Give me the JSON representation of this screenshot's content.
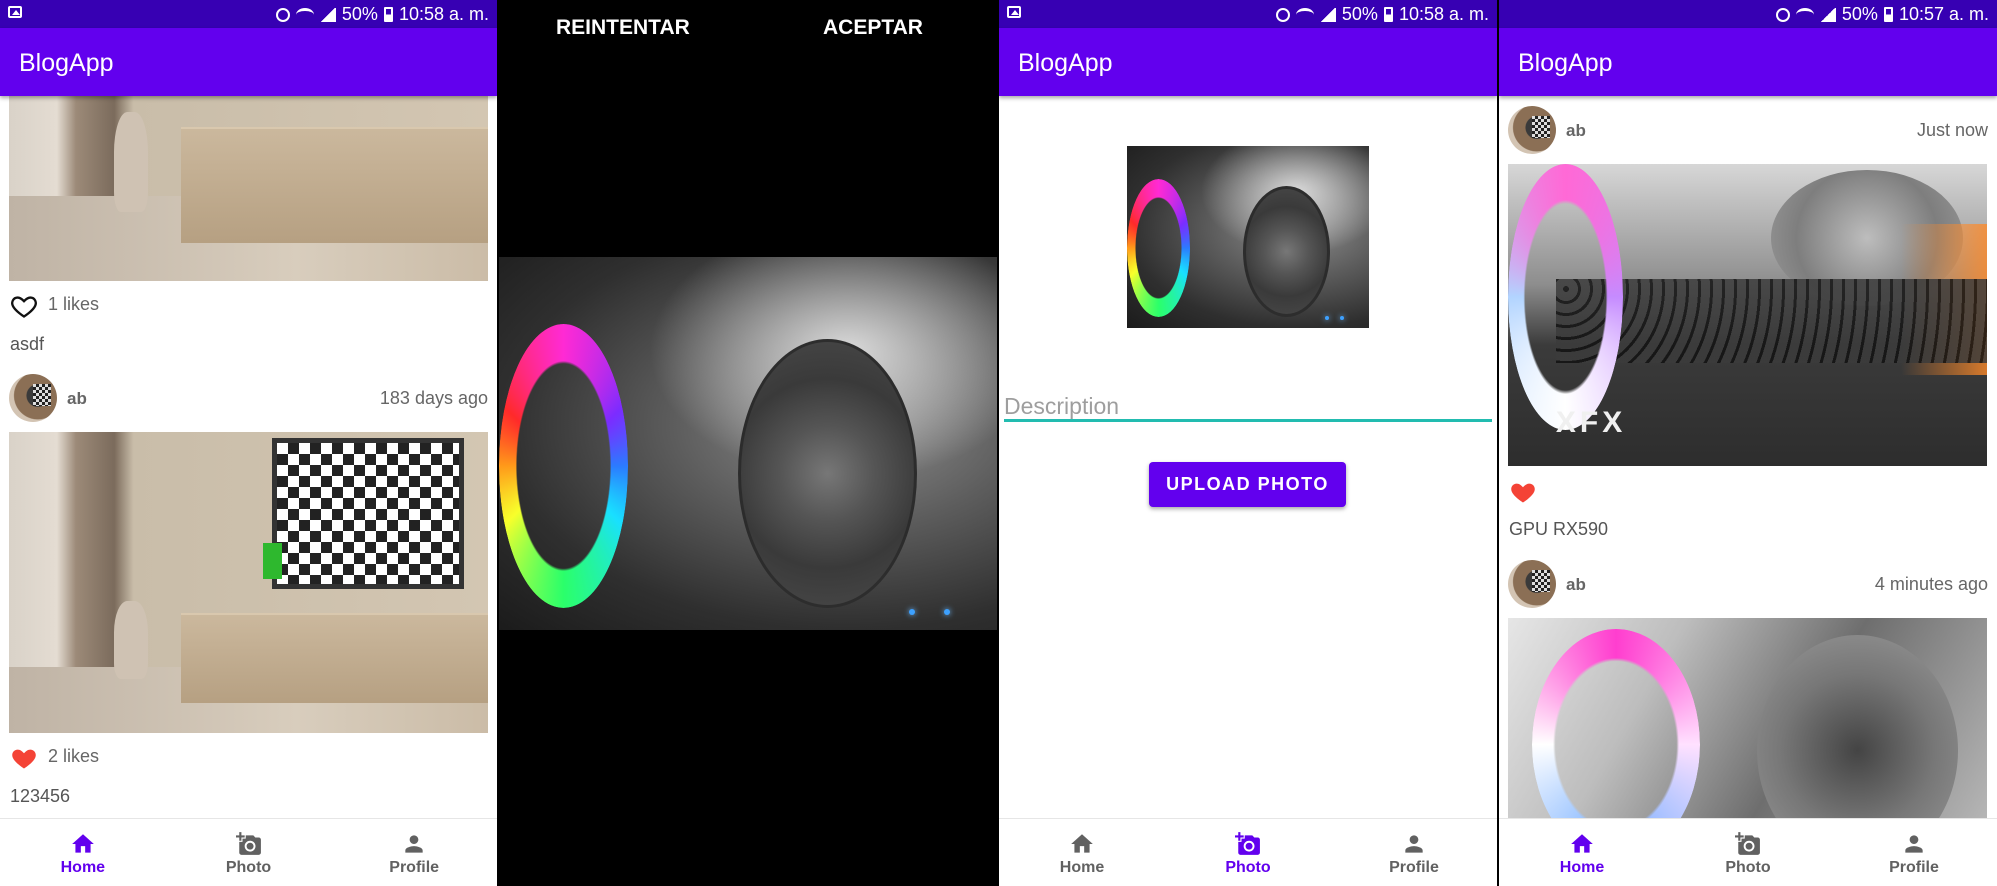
{
  "status_bars": [
    {
      "battery": "50%",
      "time": "10:58 a. m."
    },
    {
      "battery": "50%",
      "time": "10:58 a. m."
    },
    {
      "battery": "50%",
      "time": "10:57 a. m."
    }
  ],
  "app": {
    "title": "BlogApp"
  },
  "bottom_nav": [
    {
      "label": "Home",
      "icon": "home-icon"
    },
    {
      "label": "Photo",
      "icon": "add-photo-icon"
    },
    {
      "label": "Profile",
      "icon": "person-icon"
    }
  ],
  "colors": {
    "primary": "#6200ee",
    "status_bar": "#3700b3",
    "like_red": "#f44336",
    "field_underline": "#22bcb0"
  },
  "feed_screen": {
    "active_tab": "Home",
    "posts": [
      {
        "likes": "1 likes",
        "liked": false,
        "description": "asdf"
      },
      {
        "user": "ab",
        "time": "183 days ago",
        "likes": "2 likes",
        "liked": true,
        "description": "123456"
      }
    ]
  },
  "camera_screen": {
    "retry_label": "REINTENTAR",
    "accept_label": "ACEPTAR"
  },
  "upload_screen": {
    "active_tab": "Photo",
    "description_placeholder": "Description",
    "upload_button": "UPLOAD PHOTO"
  },
  "feed_screen_2": {
    "active_tab": "Home",
    "posts": [
      {
        "user": "ab",
        "time": "Just now",
        "liked": true,
        "description": "GPU RX590"
      },
      {
        "user": "ab",
        "time": "4 minutes ago"
      }
    ]
  }
}
